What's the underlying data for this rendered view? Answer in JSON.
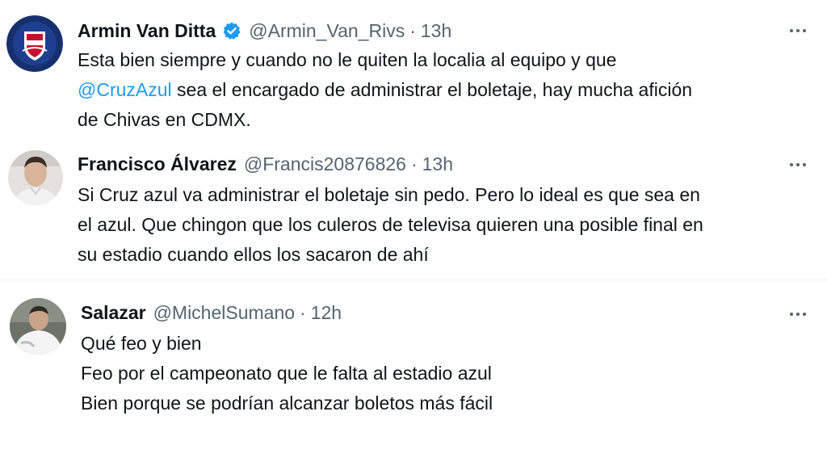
{
  "colors": {
    "accent": "#1d9bf0",
    "text": "#0f1419",
    "muted": "#536471",
    "divider": "#eff3f4"
  },
  "tweets": [
    {
      "name": "Armin Van Ditta",
      "verified": true,
      "handle": "@Armin_Van_Rivs",
      "time": "13h",
      "lines": [
        [
          "Esta bien siempre y cuando no le quiten la localia al equipo y que"
        ],
        [
          "@CruzAzul",
          " sea el encargado de administrar el boletaje, hay mucha afición"
        ],
        [
          "de Chivas en CDMX."
        ]
      ],
      "avatar_icon": "team-logo-avatar",
      "more_icon": "more-options-icon"
    },
    {
      "name": "Francisco Álvarez",
      "verified": false,
      "handle": "@Francis20876826",
      "time": "13h",
      "lines": [
        [
          "Si Cruz azul va administrar el boletaje sin pedo. Pero lo ideal es que sea en"
        ],
        [
          "el azul. Que chingon que los culeros de televisa quieren una posible final en"
        ],
        [
          "su estadio cuando ellos los sacaron de ahí"
        ]
      ],
      "avatar_icon": "user-photo-avatar",
      "more_icon": "more-options-icon"
    },
    {
      "name": "Salazar",
      "verified": false,
      "handle": "@MichelSumano",
      "time": "12h",
      "lines": [
        [
          "Qué feo y bien"
        ],
        [
          "Feo por el campeonato que le falta al estadio azul"
        ],
        [
          "Bien porque se podrían alcanzar boletos más fácil"
        ]
      ],
      "avatar_icon": "user-photo-avatar",
      "more_icon": "more-options-icon"
    }
  ],
  "separator": "·"
}
